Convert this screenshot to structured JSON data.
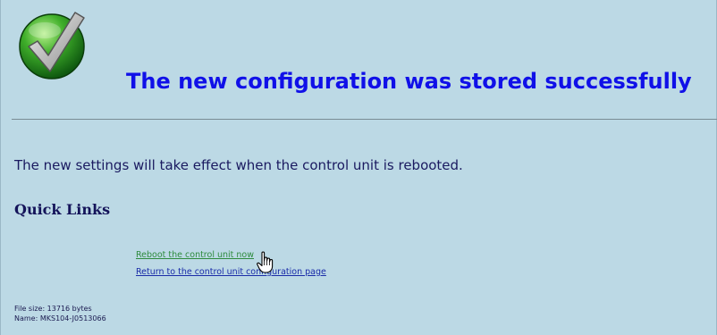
{
  "status": {
    "icon": "checkmark-success-icon",
    "title": "The new configuration was stored successfully",
    "message": "The new settings will take effect when the control unit is rebooted."
  },
  "quick_links": {
    "heading": "Quick Links",
    "items": [
      {
        "label": "Reboot the control unit now"
      },
      {
        "label": "Return to the control unit configuration page"
      }
    ]
  },
  "footer": {
    "file_size": "File size: 13716 bytes",
    "name": "Name: MKS104-J0513066"
  },
  "colors": {
    "background": "#bcd9e5",
    "title": "#1010e8",
    "text": "#1a1a60",
    "link_visited": "#2e8b3e",
    "link": "#1a2ca8"
  }
}
